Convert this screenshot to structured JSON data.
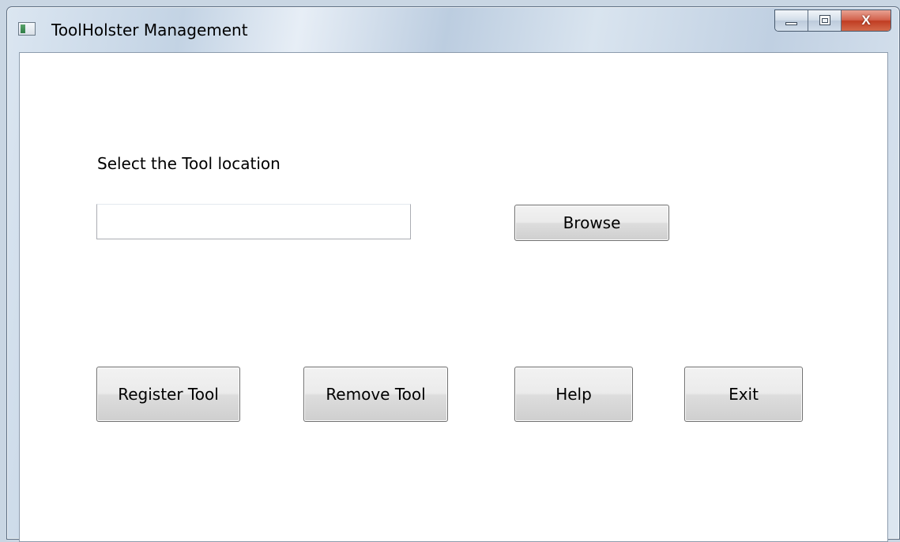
{
  "window": {
    "title": "ToolHolster Management",
    "controls": {
      "minimize": "minimize-icon",
      "maximize": "maximize-icon",
      "close": "close-icon",
      "close_glyph": "X"
    }
  },
  "main": {
    "location_label": "Select the Tool location",
    "location_input": {
      "value": "",
      "placeholder": ""
    },
    "browse_label": "Browse",
    "buttons": {
      "register": "Register Tool",
      "remove": "Remove Tool",
      "help": "Help",
      "exit": "Exit"
    }
  },
  "colors": {
    "close_button": "#c94a30",
    "window_frame": "#c3d3e4",
    "client_background": "#ffffff"
  }
}
